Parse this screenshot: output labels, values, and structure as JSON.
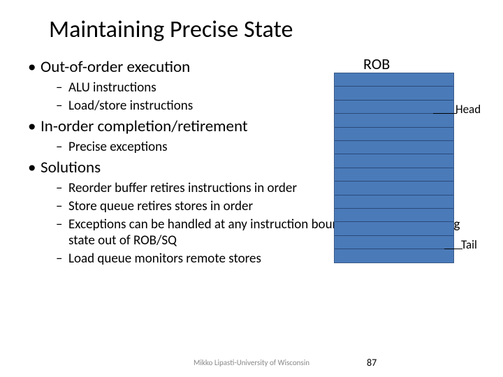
{
  "title": "Maintaining Precise State",
  "bullets": {
    "b1": "Out-of-order execution",
    "b1_1": "ALU instructions",
    "b1_2": "Load/store instructions",
    "b2": "In-order completion/retirement",
    "b2_1": "Precise exceptions",
    "b3": "Solutions",
    "b3_1": "Reorder buffer retires instructions in order",
    "b3_2": "Store queue retires stores in order",
    "b3_3": "Exceptions can be handled at any instruction boundary by reconstructing state out of ROB/SQ",
    "b3_4": "Load queue monitors remote stores"
  },
  "rob": {
    "label": "ROB",
    "head": "Head",
    "tail": "Tail"
  },
  "footer": "Mikko Lipasti-University of Wisconsin",
  "page": "87"
}
